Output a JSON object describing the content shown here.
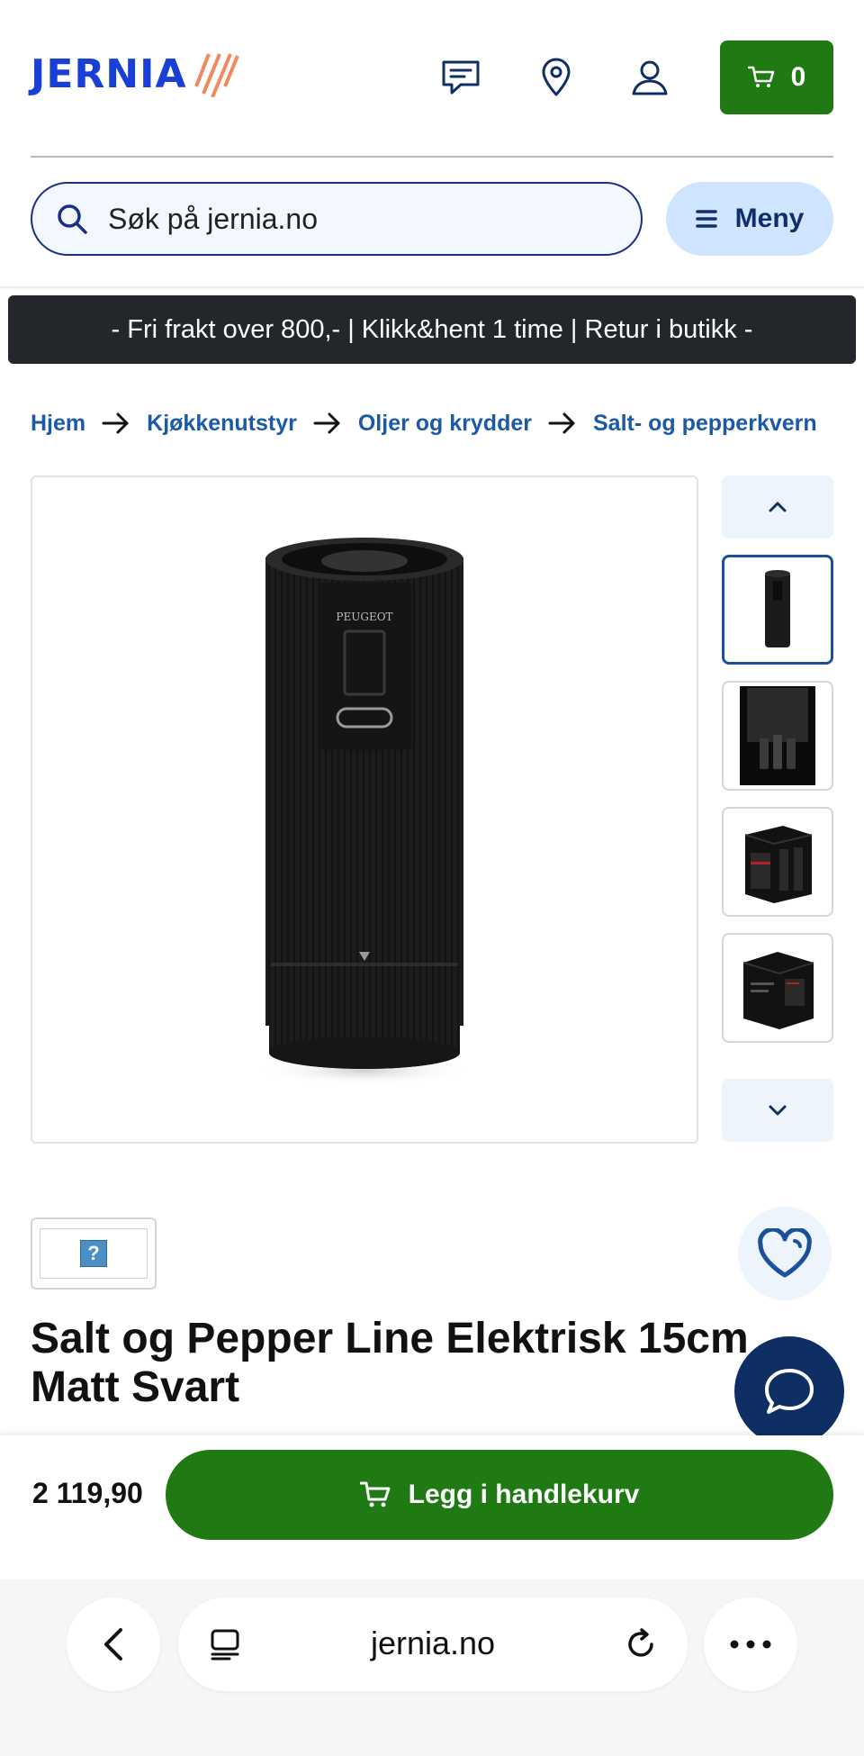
{
  "header": {
    "logo_text": "JERNIA",
    "logo_name": "jernia-logo",
    "cart_count": "0",
    "brand_color": "#1a3fd6",
    "accent_green": "#1f7a14"
  },
  "search": {
    "placeholder": "Søk på jernia.no"
  },
  "menu": {
    "label": "Meny"
  },
  "banner": {
    "text": "- Fri frakt over 800,- | Klikk&hent 1 time | Retur i butikk -"
  },
  "breadcrumb": {
    "items": [
      "Hjem",
      "Kjøkkenutstyr",
      "Oljer og krydder",
      "Salt- og pepperkvern"
    ]
  },
  "gallery": {
    "main_image": "electric-pepper-mill-photo",
    "thumbnails": [
      "mill-front",
      "mills-dark-scene",
      "gift-box-open",
      "gift-box-back"
    ],
    "active_index": 0
  },
  "product": {
    "title": "Salt og Pepper Line Elektrisk 15cm Matt Svart",
    "price": "2 119,90"
  },
  "buy": {
    "add_to_cart_label": "Legg i handlekurv"
  },
  "browser": {
    "url": "jernia.no"
  }
}
